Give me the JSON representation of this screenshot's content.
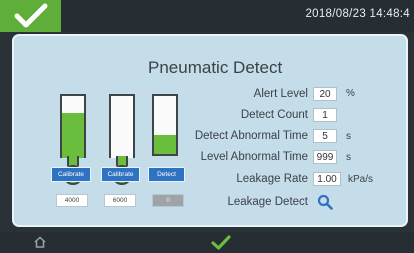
{
  "header": {
    "confirm_icon": "check-icon",
    "datetime": "2018/08/23 14:48:4"
  },
  "panel": {
    "title": "Pneumatic Detect",
    "buttons": [
      {
        "label": "Calibrate"
      },
      {
        "label": "Calibrate"
      },
      {
        "label": "Detect"
      }
    ],
    "values": [
      "4000",
      "6000",
      "0"
    ],
    "tube_fill_levels": [
      0.72,
      0.0,
      0.33
    ]
  },
  "params": {
    "alert_level": {
      "label": "Alert Level",
      "value": "20",
      "unit": "%"
    },
    "detect_count": {
      "label": "Detect Count",
      "value": "1",
      "unit": ""
    },
    "detect_abnormal_time": {
      "label": "Detect Abnormal Time",
      "value": "5",
      "unit": "s"
    },
    "level_abnormal_time": {
      "label": "Level Abnormal Time",
      "value": "999",
      "unit": "s"
    },
    "leakage_rate": {
      "label": "Leakage Rate",
      "value": "1.00",
      "unit": "kPa/s"
    },
    "leakage_detect": {
      "label": "Leakage Detect",
      "icon": "search-icon"
    }
  },
  "footer": {
    "home_icon": "home-icon",
    "confirm_icon": "check-icon"
  },
  "colors": {
    "accent_green": "#6bbd3d",
    "button_blue": "#2e72c2",
    "panel_bg": "#c5dde8"
  }
}
